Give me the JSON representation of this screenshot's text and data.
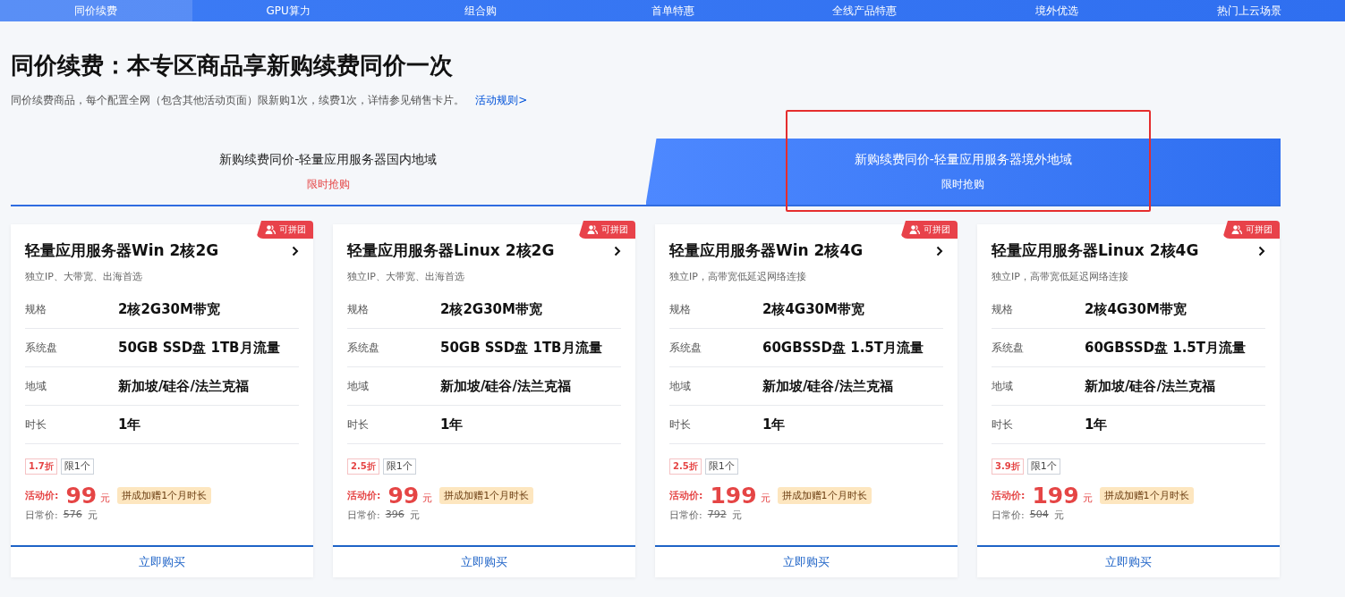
{
  "nav_tabs": [
    {
      "label": "同价续费",
      "selected": true
    },
    {
      "label": "GPU算力",
      "selected": false
    },
    {
      "label": "组合购",
      "selected": false
    },
    {
      "label": "首单特惠",
      "selected": false
    },
    {
      "label": "全线产品特惠",
      "selected": false
    },
    {
      "label": "境外优选",
      "selected": false
    },
    {
      "label": "热门上云场景",
      "selected": false
    }
  ],
  "title": "同价续费：本专区商品享新购续费同价一次",
  "subtitle": "同价续费商品，每个配置全网（包含其他活动页面）限新购1次，续费1次，详情参见销售卡片。",
  "rules_link": "活动规则>",
  "region_tabs": [
    {
      "label": "新购续费同价-轻量应用服务器国内地域",
      "tag": "限时抢购",
      "selected": false
    },
    {
      "label": "新购续费同价-轻量应用服务器境外地域",
      "tag": "限时抢购",
      "selected": true
    }
  ],
  "cards": [
    {
      "badge": "可拼团",
      "title": "轻量应用服务器Win 2核2G",
      "desc": "独立IP、大带宽、出海首选",
      "specs": [
        {
          "label": "规格",
          "value": "2核2G30M带宽"
        },
        {
          "label": "系统盘",
          "value": "50GB SSD盘 1TB月流量"
        },
        {
          "label": "地域",
          "value": "新加坡/硅谷/法兰克福"
        },
        {
          "label": "时长",
          "value": "1年"
        }
      ],
      "discount": "1.7折",
      "limit": "限1个",
      "price_label": "活动价:",
      "price": "99",
      "unit": "元",
      "promo": "拼成加赠1个月时长",
      "regular_label": "日常价:",
      "regular_price": "576",
      "regular_unit": "元",
      "buy": "立即购买"
    },
    {
      "badge": "可拼团",
      "title": "轻量应用服务器Linux 2核2G",
      "desc": "独立IP、大带宽、出海首选",
      "specs": [
        {
          "label": "规格",
          "value": "2核2G30M带宽"
        },
        {
          "label": "系统盘",
          "value": "50GB SSD盘 1TB月流量"
        },
        {
          "label": "地域",
          "value": "新加坡/硅谷/法兰克福"
        },
        {
          "label": "时长",
          "value": "1年"
        }
      ],
      "discount": "2.5折",
      "limit": "限1个",
      "price_label": "活动价:",
      "price": "99",
      "unit": "元",
      "promo": "拼成加赠1个月时长",
      "regular_label": "日常价:",
      "regular_price": "396",
      "regular_unit": "元",
      "buy": "立即购买"
    },
    {
      "badge": "可拼团",
      "title": "轻量应用服务器Win 2核4G",
      "desc": "独立IP，高带宽低延迟网络连接",
      "specs": [
        {
          "label": "规格",
          "value": "2核4G30M带宽"
        },
        {
          "label": "系统盘",
          "value": "60GBSSD盘 1.5T月流量"
        },
        {
          "label": "地域",
          "value": "新加坡/硅谷/法兰克福"
        },
        {
          "label": "时长",
          "value": "1年"
        }
      ],
      "discount": "2.5折",
      "limit": "限1个",
      "price_label": "活动价:",
      "price": "199",
      "unit": "元",
      "promo": "拼成加赠1个月时长",
      "regular_label": "日常价:",
      "regular_price": "792",
      "regular_unit": "元",
      "buy": "立即购买"
    },
    {
      "badge": "可拼团",
      "title": "轻量应用服务器Linux 2核4G",
      "desc": "独立IP，高带宽低延迟网络连接",
      "specs": [
        {
          "label": "规格",
          "value": "2核4G30M带宽"
        },
        {
          "label": "系统盘",
          "value": "60GBSSD盘 1.5T月流量"
        },
        {
          "label": "地域",
          "value": "新加坡/硅谷/法兰克福"
        },
        {
          "label": "时长",
          "value": "1年"
        }
      ],
      "discount": "3.9折",
      "limit": "限1个",
      "price_label": "活动价:",
      "price": "199",
      "unit": "元",
      "promo": "拼成加赠1个月时长",
      "regular_label": "日常价:",
      "regular_price": "504",
      "regular_unit": "元",
      "buy": "立即购买"
    }
  ]
}
